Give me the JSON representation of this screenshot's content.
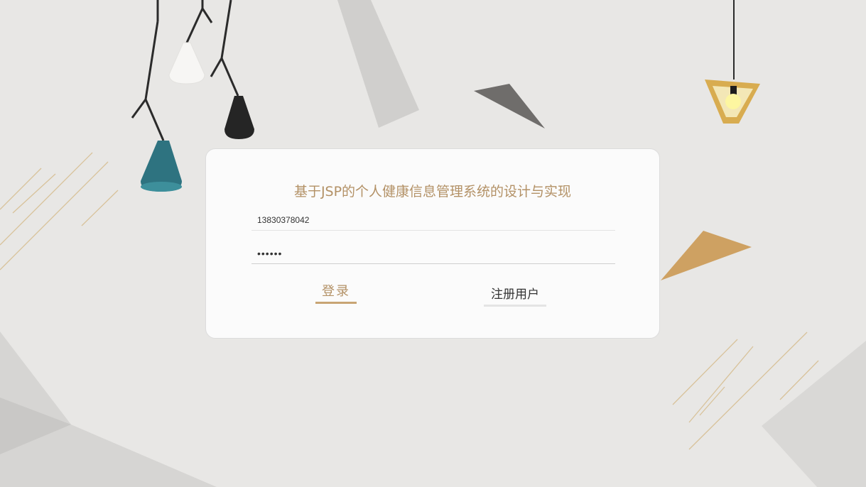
{
  "title": "基于JSP的个人健康信息管理系统的设计与实现",
  "form": {
    "account_value": "13830378042",
    "password_value": "123456"
  },
  "buttons": {
    "login_label": "登录",
    "register_label": "注册用户"
  },
  "colors": {
    "background": "#e8e7e5",
    "accent": "#b39166",
    "card": "#fbfbfb"
  },
  "icons": [
    "pendant-lamp-icon",
    "bulb-lamp-icon"
  ]
}
